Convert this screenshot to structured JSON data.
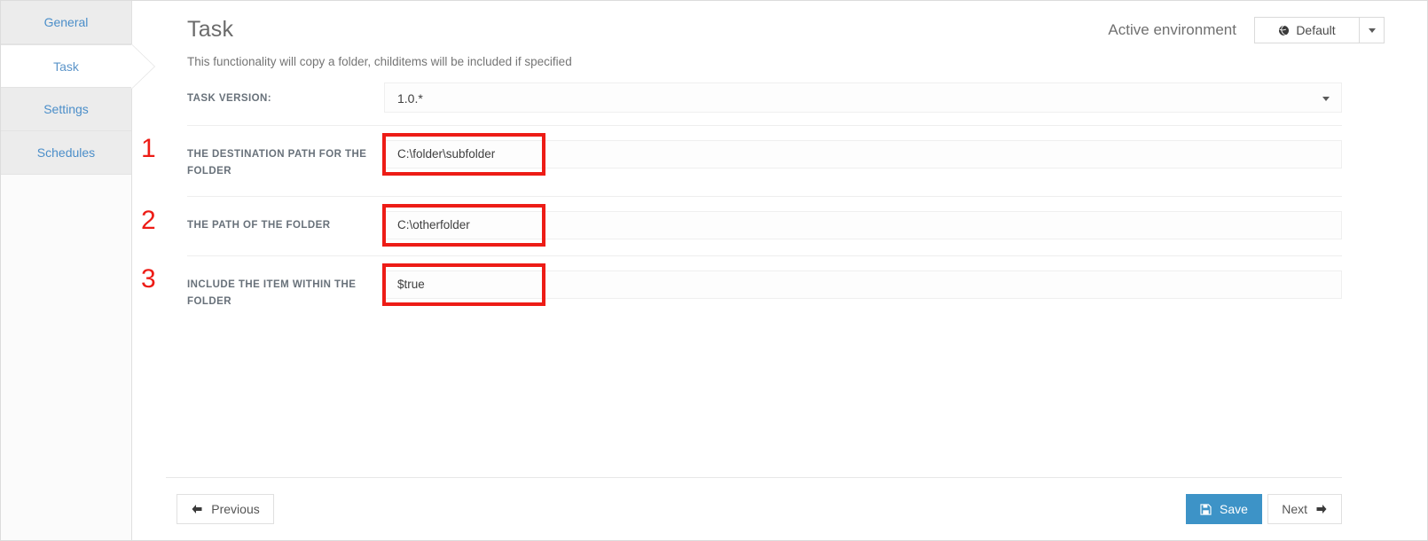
{
  "sidebar": {
    "items": [
      {
        "label": "General",
        "active": false
      },
      {
        "label": "Task",
        "active": true
      },
      {
        "label": "Settings",
        "active": false
      },
      {
        "label": "Schedules",
        "active": false
      }
    ]
  },
  "header": {
    "title": "Task",
    "subtitle": "This functionality will copy a folder, childitems will be included if specified",
    "environment_label": "Active environment",
    "environment_value": "Default",
    "environment_icon": "globe-icon",
    "environment_caret_icon": "chevron-down-icon"
  },
  "form": {
    "version": {
      "label": "TASK VERSION:",
      "value": "1.0.*",
      "caret_icon": "chevron-down-icon"
    },
    "fields": [
      {
        "number": "1",
        "label": "THE DESTINATION PATH FOR THE FOLDER",
        "value": "C:\\folder\\subfolder",
        "placeholder": ""
      },
      {
        "number": "2",
        "label": "THE PATH OF THE FOLDER",
        "value": "C:\\otherfolder",
        "placeholder": ""
      },
      {
        "number": "3",
        "label": "INCLUDE THE ITEM WITHIN THE FOLDER",
        "value": "$true",
        "placeholder": ""
      }
    ]
  },
  "footer": {
    "previous_label": "Previous",
    "previous_icon": "arrow-left-icon",
    "save_label": "Save",
    "save_icon": "floppy-disk-icon",
    "next_label": "Next",
    "next_icon": "arrow-right-icon"
  },
  "colors": {
    "accent_blue": "#3d93c7",
    "link_blue": "#4b8ec9",
    "annotation_red": "#ed1c16",
    "label_gray": "#68717a"
  }
}
